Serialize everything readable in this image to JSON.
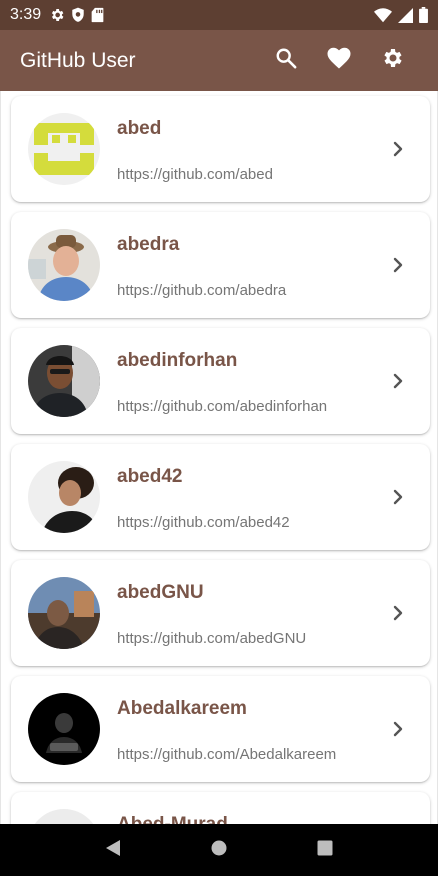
{
  "status_bar": {
    "time": "3:39",
    "left_icons": [
      "gear-icon",
      "shield-icon",
      "sd-card-icon"
    ],
    "right_icons": [
      "wifi-icon",
      "signal-icon",
      "battery-icon"
    ]
  },
  "app_bar": {
    "title": "GitHub User",
    "actions": [
      "search-icon",
      "heart-icon",
      "settings-icon"
    ]
  },
  "users": [
    {
      "login": "abed",
      "url": "https://github.com/abed",
      "avatar": "identicon"
    },
    {
      "login": "abedra",
      "url": "https://github.com/abedra",
      "avatar": "photo"
    },
    {
      "login": "abedinforhan",
      "url": "https://github.com/abedinforhan",
      "avatar": "photo"
    },
    {
      "login": "abed42",
      "url": "https://github.com/abed42",
      "avatar": "photo"
    },
    {
      "login": "abedGNU",
      "url": "https://github.com/abedGNU",
      "avatar": "photo"
    },
    {
      "login": "Abedalkareem",
      "url": "https://github.com/Abedalkareem",
      "avatar": "photo"
    },
    {
      "login": "Abed-Murad",
      "url": "",
      "avatar": "photo"
    }
  ],
  "colors": {
    "status_bar": "#5d3f32",
    "app_bar": "#795548",
    "username": "#795548",
    "url": "#757575",
    "nav_bar": "#000000"
  },
  "nav_bar": {
    "buttons": [
      "back-icon",
      "home-icon",
      "recents-icon"
    ]
  }
}
